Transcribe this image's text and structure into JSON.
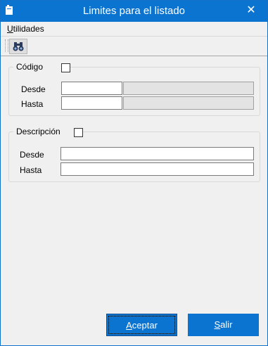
{
  "window": {
    "title": "Limites para el listado",
    "close_glyph": "✕"
  },
  "menu": {
    "utilidades_first": "U",
    "utilidades_rest": "tilidades"
  },
  "toolbar": {
    "search_icon": "binoculars-icon"
  },
  "codigo": {
    "label": "Código",
    "checked": false,
    "desde_label": "Desde",
    "hasta_label": "Hasta",
    "desde_value": "",
    "hasta_value": "",
    "desde_desc": "",
    "hasta_desc": ""
  },
  "descripcion": {
    "label": "Descripción",
    "checked": false,
    "desde_label": "Desde",
    "hasta_label": "Hasta",
    "desde_value": "",
    "hasta_value": ""
  },
  "buttons": {
    "aceptar_first": "A",
    "aceptar_rest": "ceptar",
    "salir_first": "S",
    "salir_rest": "alir"
  },
  "colors": {
    "accent": "#0b74d1",
    "window_bg": "#f0f0f0",
    "readonly_bg": "#e3e3e3"
  }
}
